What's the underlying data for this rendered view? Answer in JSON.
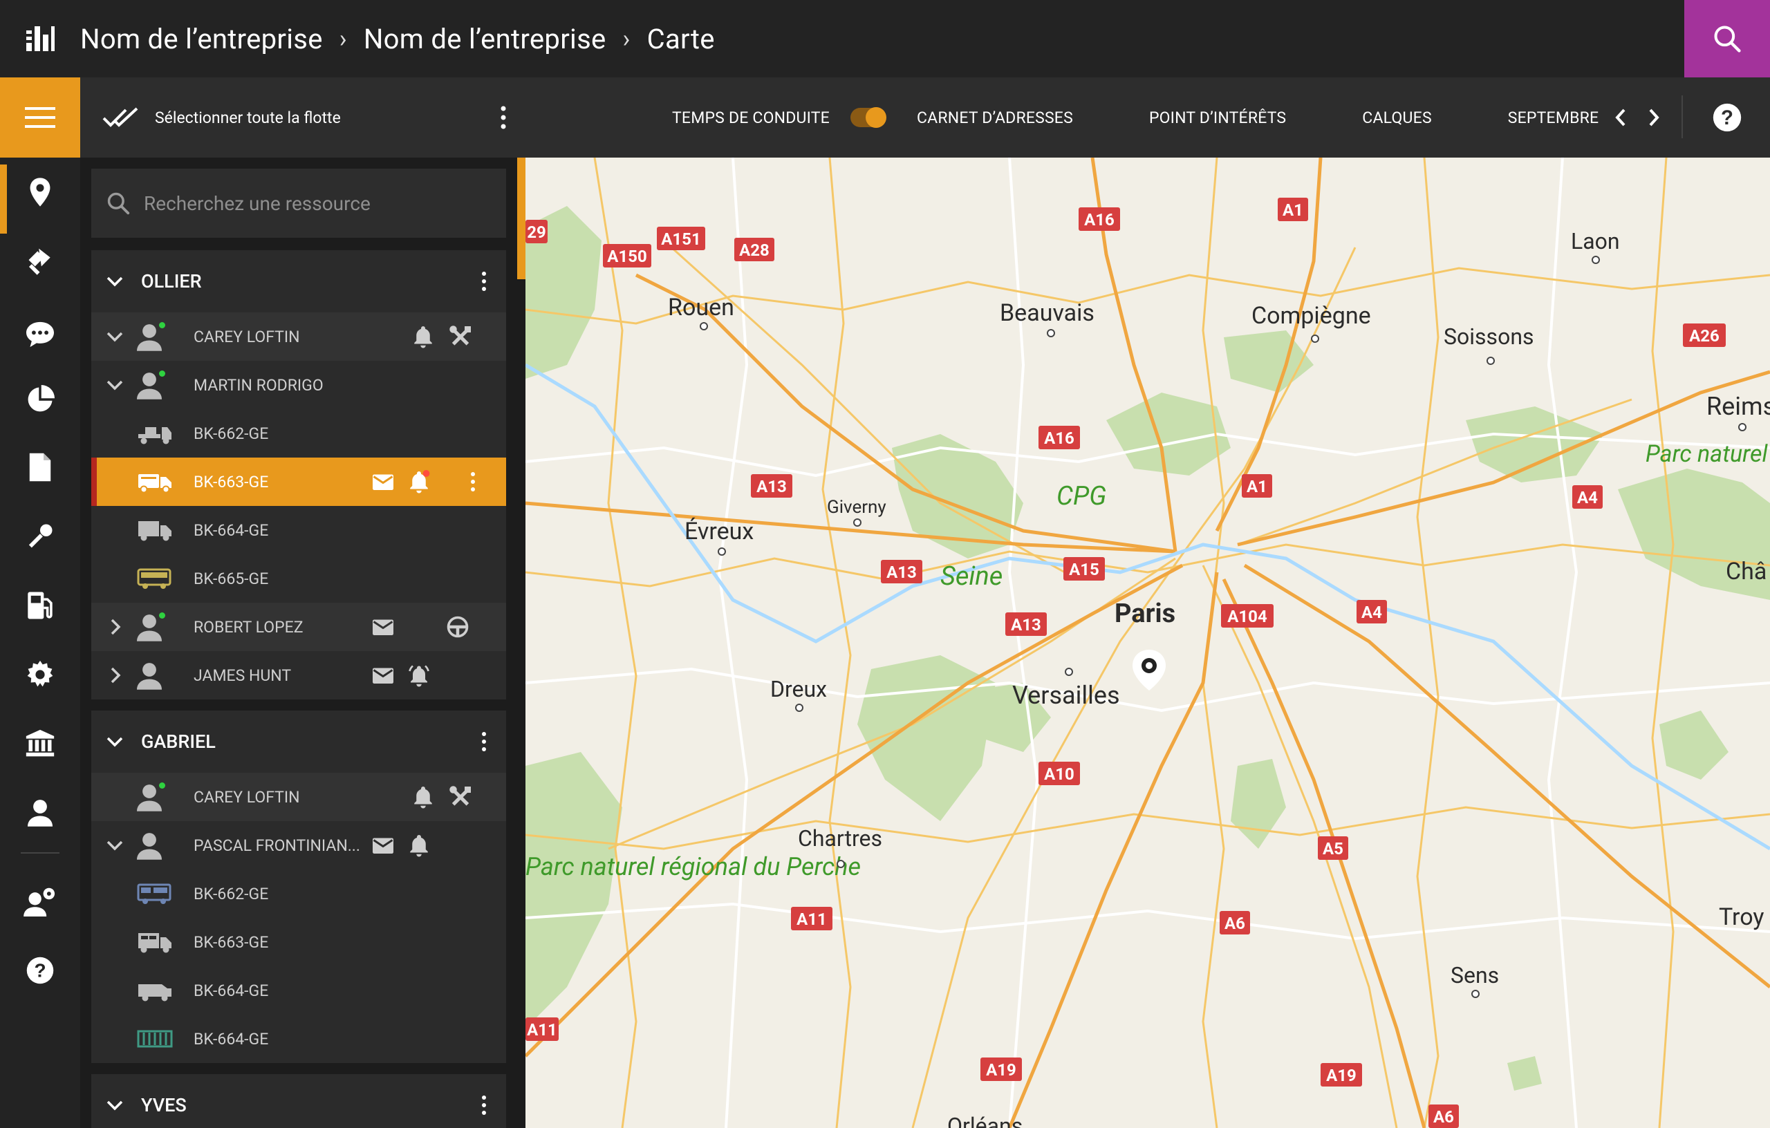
{
  "header": {
    "breadcrumbs": [
      "Nom de l’entreprise",
      "Nom de l’entreprise",
      "Carte"
    ],
    "separator": "›"
  },
  "toolbar": {
    "select_all": "Sélectionner toute la flotte",
    "driving_time": "TEMPS DE CONDUITE",
    "address_book": "CARNET D’ADRESSES",
    "poi": "POINT D’INTÉRÊTS",
    "layers": "CALQUES",
    "month": "SEPTEMBRE"
  },
  "search": {
    "placeholder": "Recherchez une ressource"
  },
  "groups": [
    {
      "name": "OLLIER",
      "rows": [
        {
          "type": "driver",
          "label": "CAREY LOFTIN"
        },
        {
          "type": "driver",
          "label": "MARTIN RODRIGO"
        },
        {
          "type": "vehicle",
          "label": "BK-662-GE"
        },
        {
          "type": "vehicle",
          "label": "BK-663-GE",
          "selected": true
        },
        {
          "type": "vehicle",
          "label": "BK-664-GE"
        },
        {
          "type": "vehicle",
          "label": "BK-665-GE"
        },
        {
          "type": "driver",
          "label": "ROBERT LOPEZ"
        },
        {
          "type": "driver",
          "label": "JAMES HUNT"
        }
      ]
    },
    {
      "name": "GABRIEL",
      "rows": [
        {
          "type": "driver",
          "label": "CAREY LOFTIN"
        },
        {
          "type": "driver",
          "label": "PASCAL FRONTINIAN..."
        },
        {
          "type": "vehicle",
          "label": "BK-662-GE"
        },
        {
          "type": "vehicle",
          "label": "BK-663-GE"
        },
        {
          "type": "vehicle",
          "label": "BK-664-GE"
        },
        {
          "type": "vehicle",
          "label": "BK-664-GE"
        }
      ]
    },
    {
      "name": "YVES",
      "rows": []
    }
  ],
  "map": {
    "cities": [
      "Rouen",
      "Beauvais",
      "Compiègne",
      "Laon",
      "Soissons",
      "Reims",
      "Évreux",
      "Giverny",
      "Paris",
      "Versailles",
      "Dreux",
      "Chartres",
      "Sens",
      "Troy",
      "Orléans",
      "Châ"
    ],
    "parks": [
      "CPG",
      "Parc naturel régional de la Montagne de Reims",
      "Parc naturel régional du Perche"
    ],
    "river": "Seine",
    "roads": [
      "A151",
      "A150",
      "A28",
      "A16",
      "A1",
      "A26",
      "A16",
      "A13",
      "A1",
      "A4",
      "A13",
      "A15",
      "A13",
      "A104",
      "A4",
      "A10",
      "A5",
      "A11",
      "A6",
      "A19",
      "A19",
      "A11",
      "A6",
      "29"
    ]
  },
  "colors": {
    "accent": "#e8991d",
    "search_bg": "#a3339b",
    "alert_dot": "#ff4d3d",
    "online_dot": "#2fd240"
  }
}
